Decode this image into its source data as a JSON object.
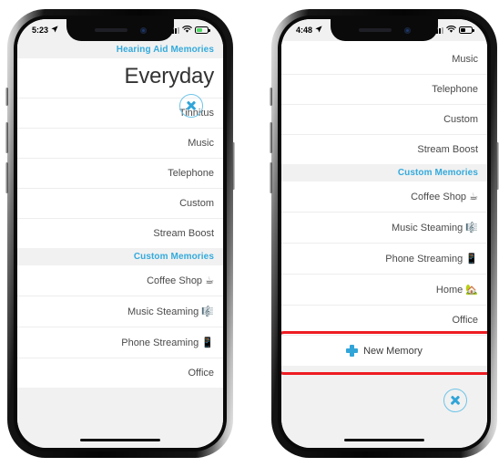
{
  "colors": {
    "accent_blue": "#34aadc",
    "plus_blue": "#32a5d8",
    "highlight_red": "#ee1c22",
    "screen_bg": "#f1f1f1",
    "sheet_white": "#ffffff",
    "battery_charging_green": "#4cd964"
  },
  "phones": [
    {
      "id": "left",
      "status_bar": {
        "time": "5:23",
        "location_arrow": "➤",
        "signal_icon": "cellular-signal-icon",
        "wifi_icon": "wifi-icon",
        "battery_icon": "battery-charging-icon",
        "battery_level_pct": 55,
        "battery_color": "#4cd964"
      },
      "sections": [
        {
          "header": "Hearing Aid Memories",
          "title": "Everyday",
          "rows": [
            {
              "label": "Tinnitus",
              "emoji": ""
            },
            {
              "label": "Music",
              "emoji": ""
            },
            {
              "label": "Telephone",
              "emoji": ""
            },
            {
              "label": "Custom",
              "emoji": ""
            },
            {
              "label": "Stream Boost",
              "emoji": ""
            }
          ]
        },
        {
          "header": "Custom Memories",
          "title": "",
          "rows": [
            {
              "label": "Coffee Shop",
              "emoji": "☕"
            },
            {
              "label": "Music Steaming",
              "emoji": "🎼"
            },
            {
              "label": "Phone Streaming",
              "emoji": "📱"
            },
            {
              "label": "Office",
              "emoji": ""
            }
          ]
        }
      ],
      "close_button": {
        "name": "close-button",
        "glyph": "✕"
      },
      "highlight": null
    },
    {
      "id": "right",
      "status_bar": {
        "time": "4:48",
        "location_arrow": "➤",
        "signal_icon": "cellular-signal-icon",
        "wifi_icon": "wifi-icon",
        "battery_icon": "battery-icon",
        "battery_level_pct": 45,
        "battery_color": "#000000"
      },
      "sections": [
        {
          "header": "",
          "title": "",
          "rows": [
            {
              "label": "Music",
              "emoji": ""
            },
            {
              "label": "Telephone",
              "emoji": ""
            },
            {
              "label": "Custom",
              "emoji": ""
            },
            {
              "label": "Stream Boost",
              "emoji": ""
            }
          ]
        },
        {
          "header": "Custom Memories",
          "title": "",
          "rows": [
            {
              "label": "Coffee Shop",
              "emoji": "☕"
            },
            {
              "label": "Music Steaming",
              "emoji": "🎼"
            },
            {
              "label": "Phone Streaming",
              "emoji": "📱"
            },
            {
              "label": "Home",
              "emoji": "🏡"
            },
            {
              "label": "Office",
              "emoji": ""
            }
          ]
        }
      ],
      "new_memory": {
        "label": "New Memory",
        "icon": "plus-icon",
        "highlighted": true
      },
      "close_button": {
        "name": "close-button",
        "glyph": "✕"
      },
      "highlight": {
        "target": "new-memory-row",
        "color": "#ee1c22"
      }
    }
  ]
}
